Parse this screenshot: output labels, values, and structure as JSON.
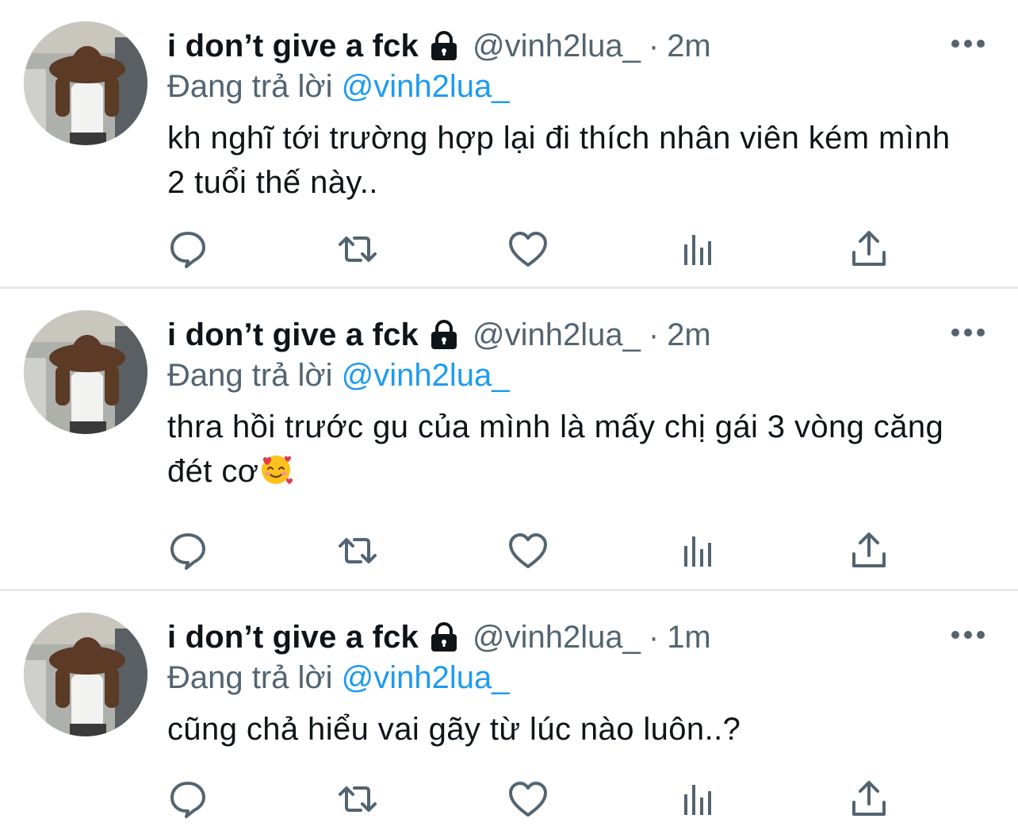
{
  "tweets": [
    {
      "name": "i don’t give a fck",
      "handle": "@vinh2lua_",
      "dot": "·",
      "time": "2m",
      "reply_prefix": "Đang trả lời ",
      "reply_mention": "@vinh2lua_",
      "text": "kh nghĩ tới trường hợp lại đi thích nhân viên kém mình 2 tuổi thế này..",
      "emoji": ""
    },
    {
      "name": "i don’t give a fck",
      "handle": "@vinh2lua_",
      "dot": "·",
      "time": "2m",
      "reply_prefix": "Đang trả lời ",
      "reply_mention": "@vinh2lua_",
      "text": "thra hồi trước gu của mình là mấy chị gái 3 vòng căng đét cơ",
      "emoji": "smiling-face-with-hearts"
    },
    {
      "name": "i don’t give a fck",
      "handle": "@vinh2lua_",
      "dot": "·",
      "time": "1m",
      "reply_prefix": "Đang trả lời ",
      "reply_mention": "@vinh2lua_",
      "text": "cũng chả hiểu vai gãy từ lúc nào luôn..?",
      "emoji": ""
    }
  ],
  "icons": {
    "lock": "lock-icon",
    "more": "more-icon",
    "reply": "reply-icon",
    "retweet": "retweet-icon",
    "like": "like-icon",
    "views": "views-icon",
    "share": "share-icon"
  },
  "colors": {
    "text": "#0f1419",
    "secondary": "#536471",
    "mention": "#1d9bf0",
    "divider": "#e6e9ea"
  }
}
